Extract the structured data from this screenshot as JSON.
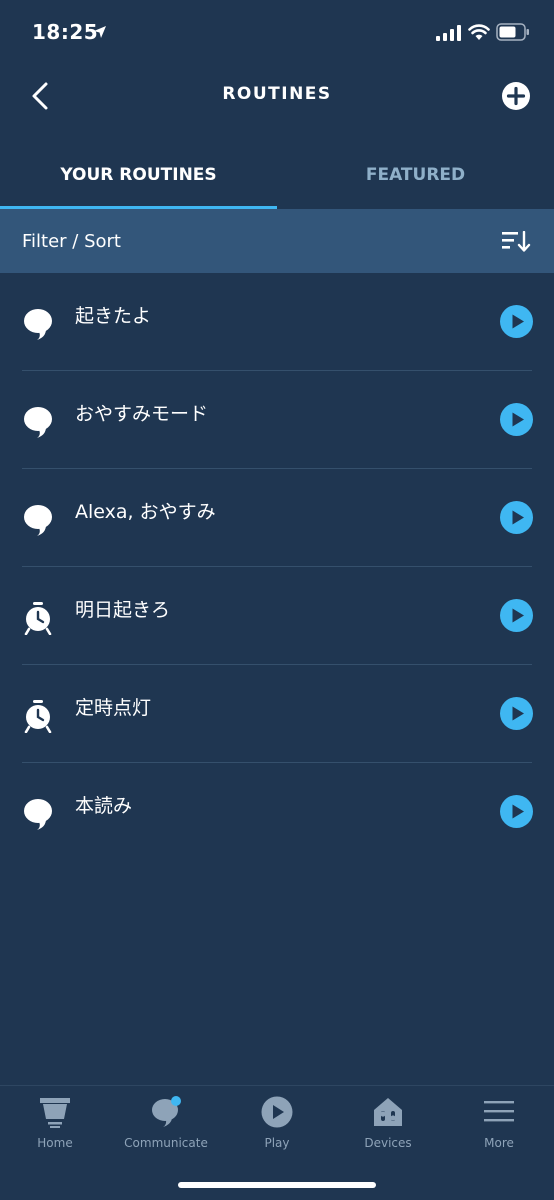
{
  "status_bar": {
    "time": "18:25"
  },
  "header": {
    "title": "ROUTINES"
  },
  "tabs": [
    {
      "label": "YOUR ROUTINES",
      "active": true
    },
    {
      "label": "FEATURED",
      "active": false
    }
  ],
  "filter": {
    "label": "Filter / Sort"
  },
  "routines": [
    {
      "label": "起きたよ",
      "icon": "speech-bubble-icon"
    },
    {
      "label": "おやすみモード",
      "icon": "speech-bubble-icon"
    },
    {
      "label": "Alexa, おやすみ",
      "icon": "speech-bubble-icon"
    },
    {
      "label": "明日起きろ",
      "icon": "alarm-clock-icon"
    },
    {
      "label": "定時点灯",
      "icon": "alarm-clock-icon"
    },
    {
      "label": "本読み",
      "icon": "speech-bubble-icon"
    }
  ],
  "bottom_nav": [
    {
      "label": "Home",
      "icon": "home-icon"
    },
    {
      "label": "Communicate",
      "icon": "communicate-icon"
    },
    {
      "label": "Play",
      "icon": "play-icon"
    },
    {
      "label": "Devices",
      "icon": "devices-icon"
    },
    {
      "label": "More",
      "icon": "menu-icon"
    }
  ],
  "colors": {
    "background": "#1f3651",
    "accent": "#3fb7f2",
    "filter_bar": "#33567a",
    "inactive_tab": "#8fb0c9"
  }
}
